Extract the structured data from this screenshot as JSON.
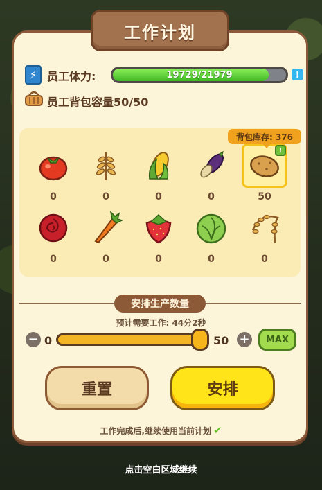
{
  "dialog": {
    "title": "工作计划"
  },
  "stamina": {
    "label": "员工体力:",
    "current": 19729,
    "max": 21979,
    "text": "19729/21979",
    "fill_fraction": 0.898,
    "info_icon": "info-icon"
  },
  "backpack": {
    "label": "员工背包容量50/50"
  },
  "stock": {
    "label": "背包库存: 376"
  },
  "crops": [
    {
      "name": "tomato",
      "count": "0"
    },
    {
      "name": "wheat",
      "count": "0"
    },
    {
      "name": "corn",
      "count": "0"
    },
    {
      "name": "eggplant",
      "count": "0"
    },
    {
      "name": "potato",
      "count": "50"
    },
    {
      "name": "rose",
      "count": "0"
    },
    {
      "name": "carrot",
      "count": "0"
    },
    {
      "name": "strawberry",
      "count": "0"
    },
    {
      "name": "cabbage",
      "count": "0"
    },
    {
      "name": "rice",
      "count": "0"
    }
  ],
  "production": {
    "title": "安排生产数量",
    "estimate": "预计需要工作: 44分2秒",
    "min": "0",
    "max": "50",
    "value_fraction": 1.0,
    "max_label": "MAX"
  },
  "buttons": {
    "reset": "重置",
    "arrange": "安排"
  },
  "footer": {
    "continue_plan": "工作完成后,继续使用当前计划",
    "tap_hint": "点击空白区域继续"
  },
  "colors": {
    "panel": "#fdf5d9",
    "border": "#8b5a3a",
    "accent_yellow": "#ffe419",
    "stamina_green": "#3fb824"
  }
}
